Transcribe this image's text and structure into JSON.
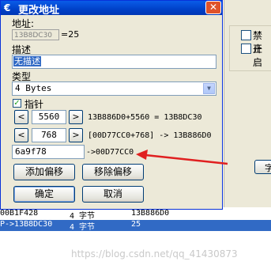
{
  "dialog": {
    "title": "更改地址",
    "close_glyph": "✕",
    "address_label": "地址:",
    "address_value": "13B8DC30",
    "address_result": "=25",
    "description_label": "描述",
    "description_value": "无描述",
    "type_label": "类型",
    "type_value": "4 Bytes",
    "pointer_label": "指针",
    "pointer_checked": true,
    "offsets": [
      {
        "value": "5560",
        "calc": "13B886D0+5560 = 13B8DC30"
      },
      {
        "value": "768",
        "calc": "[00D77CC0+768] -> 13B886D0"
      }
    ],
    "base_address": "6a9f78",
    "base_result": "->00D77CC0",
    "buttons": {
      "add_offset": "添加偏移",
      "remove_offset": "移除偏移",
      "ok": "确定",
      "cancel": "取消"
    },
    "stepper_left": "<",
    "stepper_right": ">"
  },
  "background": {
    "checkbox_1": "禁止",
    "checkbox_2": "开启",
    "partial_button": "字",
    "rows": [
      {
        "addr": "00B1F428",
        "type": "4 字节",
        "value": "13B886D0"
      },
      {
        "addr": "P->13B8DC30",
        "type": "4 字节",
        "value": "25"
      }
    ],
    "watermark": "https://blog.csdn.net/qq_41430873"
  },
  "colors": {
    "title_bar": "#0041c8",
    "selection": "#316ac5",
    "annotation_arrow": "#e02020"
  }
}
